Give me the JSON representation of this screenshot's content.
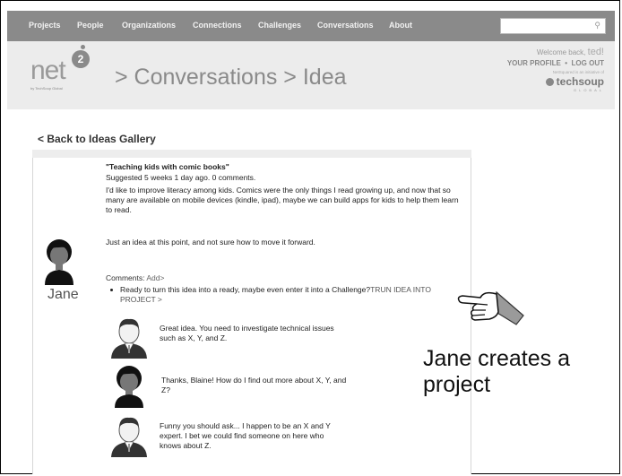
{
  "nav": {
    "items": [
      "Projects",
      "People",
      "Organizations",
      "Connections",
      "Challenges",
      "Conversations",
      "About"
    ]
  },
  "search": {
    "icon": "search-icon"
  },
  "header": {
    "logo_text": "net",
    "logo_badge": "2",
    "logo_sub": "by TechSoup Global",
    "breadcrumb": "> Conversations > Idea",
    "welcome_prefix": "Welcome back,",
    "welcome_user": "ted!",
    "your_profile": "YOUR PROFILE",
    "separator": "•",
    "log_out": "LOG OUT",
    "initiative": "NetSquared is an initiative of",
    "techsoup": "techsoup",
    "techsoup_global": "GLOBAL"
  },
  "back_link": "< Back to Ideas Gallery",
  "idea": {
    "title": "\"Teaching kids with comic books\"",
    "meta": "Suggested 5 weeks 1 day ago. 0 comments.",
    "body": "I'd like to improve literacy among kids. Comics were the only things I read growing up, and now that so many are available on mobile devices (kindle, ipad), maybe we can build apps for kids to help them learn to read.",
    "note": "Just an idea at this point, and not sure how to move it forward."
  },
  "author": {
    "name": "Jane"
  },
  "comments": {
    "label": "Comments:",
    "add": "Add>",
    "prompt": "Ready to turn this idea into a ready, maybe even enter it into a Challenge?",
    "prompt_link": "TRUN IDEA INTO PROJECT >",
    "items": [
      "Great idea. You need to investigate technical issues such as X, Y, and Z.",
      "Thanks, Blaine! How do I find out more about X, Y, and Z?",
      "Funny you should ask... I happen to be an X and Y expert. I bet we could find someone on here who knows about Z."
    ]
  },
  "annotation": {
    "line1": "Jane creates a",
    "line2": "project"
  },
  "colors": {
    "nav_bg": "#8a8a8a",
    "header_bg": "#ececec",
    "text": "#222222"
  }
}
